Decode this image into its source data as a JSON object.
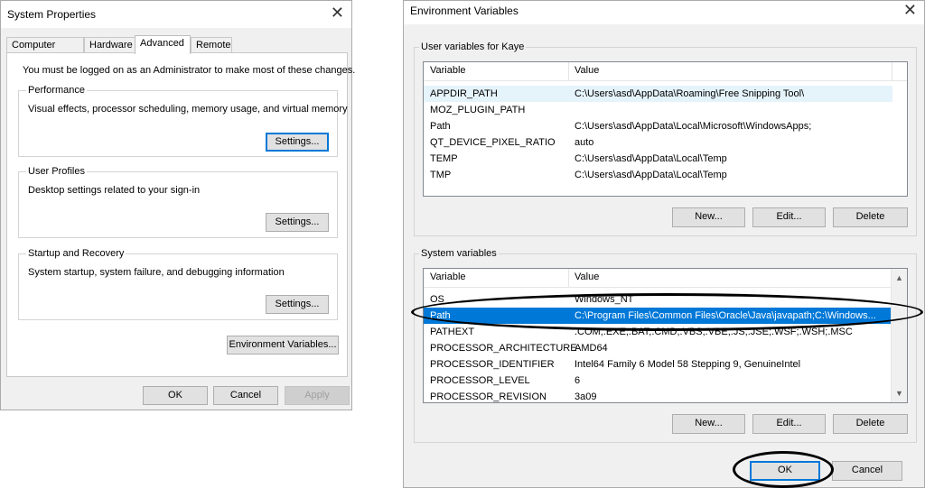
{
  "sysprops": {
    "title": "System Properties",
    "tabs": [
      "Computer Name",
      "Hardware",
      "Advanced",
      "Remote"
    ],
    "admin_note": "You must be logged on as an Administrator to make most of these changes.",
    "performance": {
      "title": "Performance",
      "desc": "Visual effects, processor scheduling, memory usage, and virtual memory",
      "button": "Settings..."
    },
    "profiles": {
      "title": "User Profiles",
      "desc": "Desktop settings related to your sign-in",
      "button": "Settings..."
    },
    "startup": {
      "title": "Startup and Recovery",
      "desc": "System startup, system failure, and debugging information",
      "button": "Settings..."
    },
    "env_button": "Environment Variables...",
    "ok": "OK",
    "cancel": "Cancel",
    "apply": "Apply"
  },
  "envvars": {
    "title": "Environment Variables",
    "user_group": "User variables for Kaye",
    "col_variable": "Variable",
    "col_value": "Value",
    "user_rows": [
      {
        "variable": "APPDIR_PATH",
        "value": "C:\\Users\\asd\\AppData\\Roaming\\Free Snipping Tool\\"
      },
      {
        "variable": "MOZ_PLUGIN_PATH",
        "value": ""
      },
      {
        "variable": "Path",
        "value": "C:\\Users\\asd\\AppData\\Local\\Microsoft\\WindowsApps;"
      },
      {
        "variable": "QT_DEVICE_PIXEL_RATIO",
        "value": "auto"
      },
      {
        "variable": "TEMP",
        "value": "C:\\Users\\asd\\AppData\\Local\\Temp"
      },
      {
        "variable": "TMP",
        "value": "C:\\Users\\asd\\AppData\\Local\\Temp"
      }
    ],
    "user_new": "New...",
    "user_edit": "Edit...",
    "user_delete": "Delete",
    "system_group": "System variables",
    "system_rows": [
      {
        "variable": "OS",
        "value": "Windows_NT"
      },
      {
        "variable": "Path",
        "value": "C:\\Program Files\\Common Files\\Oracle\\Java\\javapath;C:\\Windows..."
      },
      {
        "variable": "PATHEXT",
        "value": ".COM;.EXE;.BAT;.CMD;.VBS;.VBE;.JS;.JSE;.WSF;.WSH;.MSC"
      },
      {
        "variable": "PROCESSOR_ARCHITECTURE",
        "value": "AMD64"
      },
      {
        "variable": "PROCESSOR_IDENTIFIER",
        "value": "Intel64 Family 6 Model 58 Stepping 9, GenuineIntel"
      },
      {
        "variable": "PROCESSOR_LEVEL",
        "value": "6"
      },
      {
        "variable": "PROCESSOR_REVISION",
        "value": "3a09"
      }
    ],
    "sys_new": "New...",
    "sys_edit": "Edit...",
    "sys_delete": "Delete",
    "ok": "OK",
    "cancel": "Cancel"
  },
  "icons": {
    "close": "close-icon",
    "scroll_up": "chevron-up-icon",
    "scroll_down": "chevron-down-icon"
  },
  "colors": {
    "selection": "#0078d7",
    "hover_row": "#e5f3fb",
    "annotation": "#000000"
  }
}
